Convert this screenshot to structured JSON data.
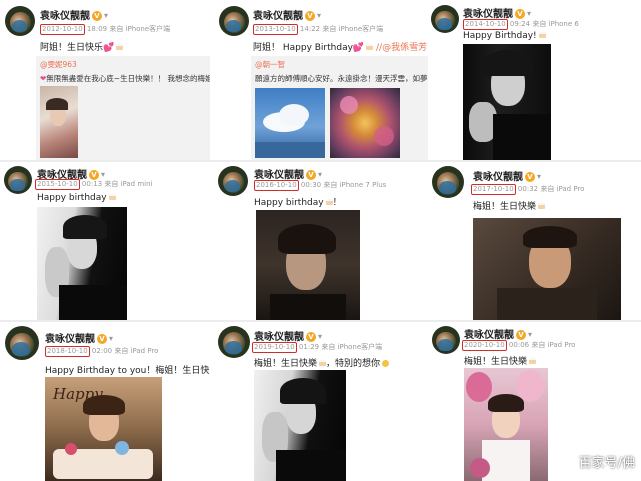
{
  "posts": [
    {
      "user": "袁咏仪靓靓",
      "date": "2012-10-10",
      "meta": "18:09 来自 iPhone客户端",
      "text": "阿姐！生日快乐",
      "repost": {
        "user": "@雯妮963",
        "text": "無限無盡愛在我心底~生日快樂！！ 我想念的梅姐"
      }
    },
    {
      "user": "袁咏仪靓靓",
      "date": "2013-10-10",
      "meta": "14:22 来自 iPhone客户端",
      "text": "阿姐！ Happy Birthday",
      "text_extra": "//@我係雪芳",
      "repost": {
        "user": "@朝一智",
        "text": "願遠方的師傅順心安好。永遠掛念！漫天浮雲，如夢"
      }
    },
    {
      "user": "袁咏仪靓靓",
      "date": "2014-10-10",
      "meta": "09:24 来自 iPhone 6",
      "text": "Happy Birthday!"
    },
    {
      "user": "袁咏仪靓靓",
      "date": "2015-10-10",
      "meta": "00:13 来自 iPad mini",
      "text": "Happy birthday"
    },
    {
      "user": "袁咏仪靓靓",
      "date": "2016-10-10",
      "meta": "00:30 来自 iPhone 7 Plus",
      "text": "Happy birthday",
      "text_suffix": "！"
    },
    {
      "user": "袁咏仪靓靓",
      "date": "2017-10-10",
      "meta": "00:32 来自 iPad Pro",
      "text": "梅姐！生日快樂"
    },
    {
      "user": "袁咏仪靓靓",
      "date": "2018-10-10",
      "meta": "02:00 来自 iPad Pro",
      "text": "Happy Birthday to you！梅姐！生日快"
    },
    {
      "user": "袁咏仪靓靓",
      "date": "2019-10-10",
      "meta": "01:29 来自 iPhone客户端",
      "text": "梅姐！生日快樂",
      "text_suffix": "，特別的想你"
    },
    {
      "user": "袁咏仪靓靓",
      "date": "2020-10-10",
      "meta": "00:06 来自 iPad Pro",
      "text": "梅姐！生日快樂"
    }
  ],
  "watermark": "百家号/佛",
  "colors": {
    "date_highlight": "#d12b2b",
    "vip_badge": "#f5a623",
    "mention": "#eb7350"
  },
  "icons": {
    "vip": "v-badge-icon",
    "dropdown": "chevron-down-icon"
  }
}
